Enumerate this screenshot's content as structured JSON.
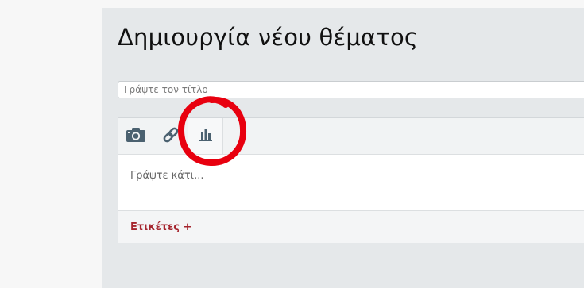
{
  "page": {
    "title": "Δημιουργία νέου θέματος"
  },
  "form": {
    "title_placeholder": "Γράψτε τον τίτλο",
    "title_value": "",
    "body_placeholder": "Γράψτε κάτι...",
    "tags_label": "Ετικέτες +"
  },
  "toolbar": {
    "buttons": [
      {
        "icon": "camera-icon"
      },
      {
        "icon": "link-icon"
      },
      {
        "icon": "bar-chart-icon"
      }
    ]
  },
  "colors": {
    "panel_bg": "#e5e8ea",
    "icon": "#4b6170",
    "tags_accent": "#a5242d",
    "annotation": "#e8000f"
  }
}
